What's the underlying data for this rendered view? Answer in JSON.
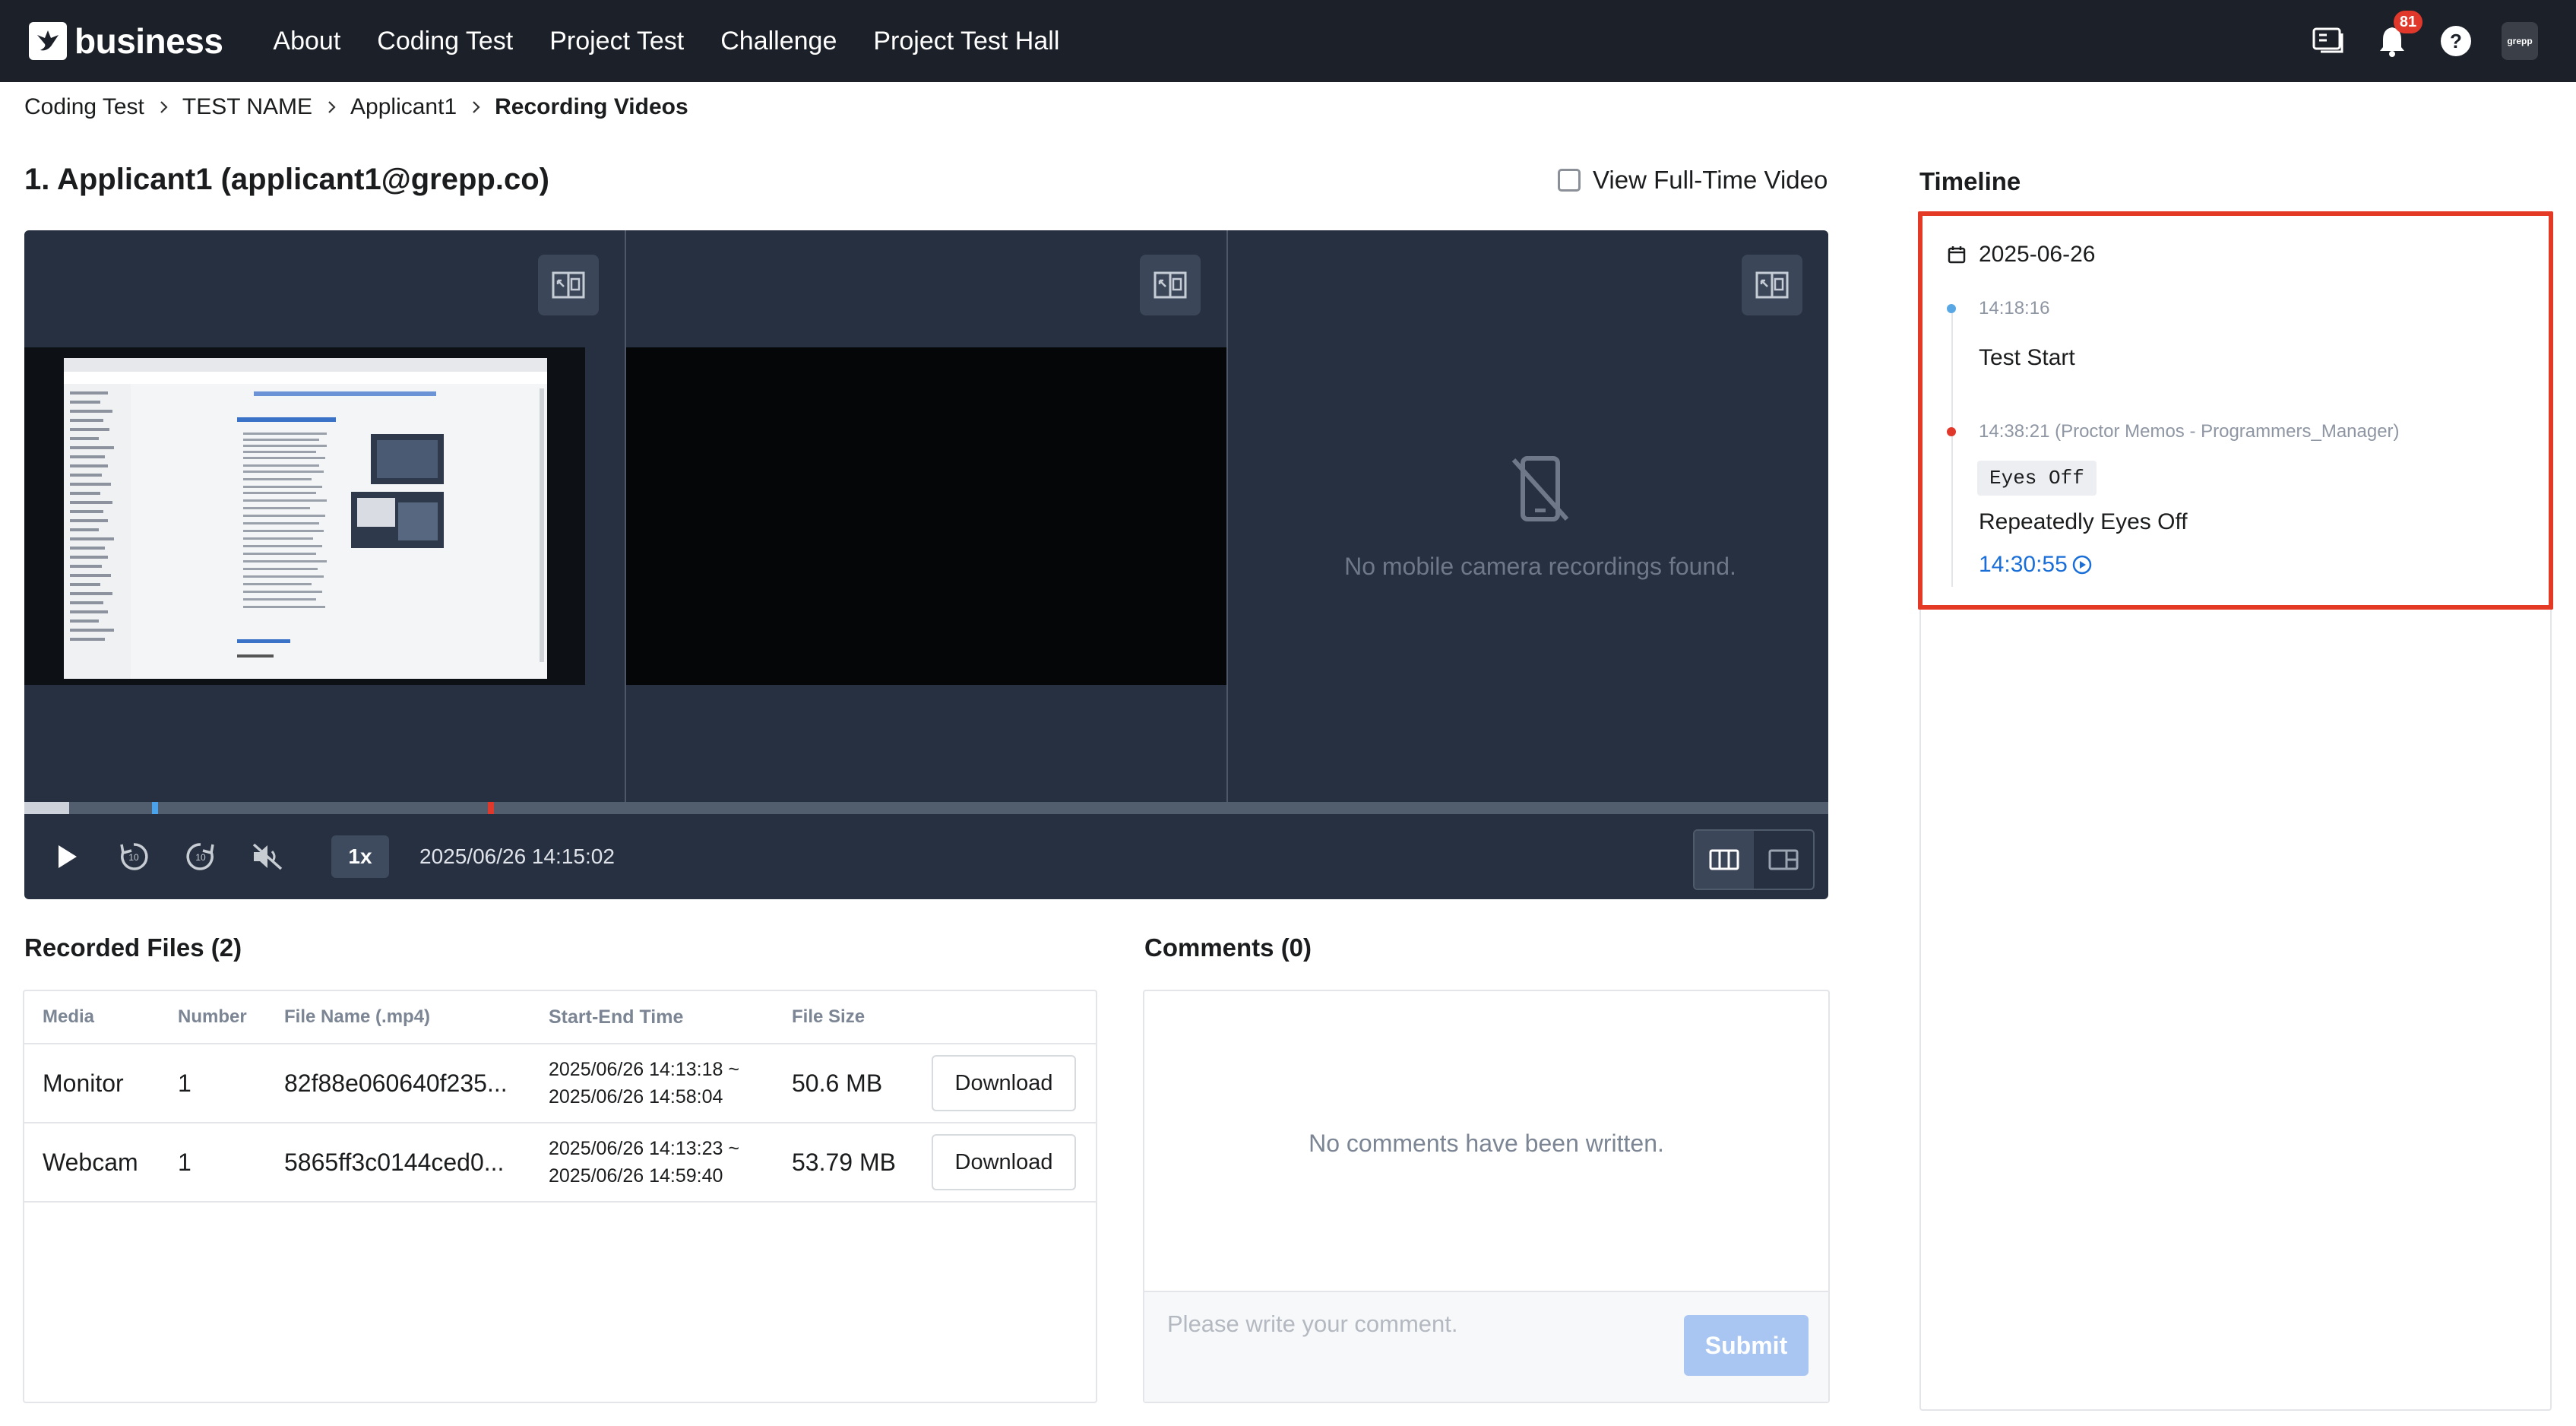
{
  "header": {
    "brand": "business",
    "nav": [
      "About",
      "Coding Test",
      "Project Test",
      "Challenge",
      "Project Test Hall"
    ],
    "notification_count": "81",
    "avatar_text": "grepp"
  },
  "breadcrumb": [
    "Coding Test",
    "TEST NAME",
    "Applicant1",
    "Recording Videos"
  ],
  "applicant": {
    "title": "1. Applicant1 (applicant1@grepp.co)",
    "fulltime_label": "View Full-Time Video"
  },
  "player": {
    "no_mobile_text": "No mobile camera recordings found.",
    "speed": "1x",
    "timestamp": "2025/06/26 14:15:02",
    "progress": 0.025
  },
  "recorded_files": {
    "title": "Recorded Files (2)",
    "columns": [
      "Media",
      "Number",
      "File Name (.mp4)",
      "Start-End Time",
      "File Size"
    ],
    "rows": [
      {
        "media": "Monitor",
        "number": "1",
        "file_name": "82f88e060640f235...",
        "start": "2025/06/26 14:13:18 ~",
        "end": "2025/06/26 14:58:04",
        "size": "50.6 MB",
        "action": "Download"
      },
      {
        "media": "Webcam",
        "number": "1",
        "file_name": "5865ff3c0144ced0...",
        "start": "2025/06/26 14:13:23 ~",
        "end": "2025/06/26 14:59:40",
        "size": "53.79 MB",
        "action": "Download"
      }
    ]
  },
  "comments": {
    "title": "Comments (0)",
    "empty_text": "No comments have been written.",
    "placeholder": "Please write your comment.",
    "submit": "Submit"
  },
  "timeline": {
    "title": "Timeline",
    "date": "2025-06-26",
    "events": [
      {
        "time": "14:18:16",
        "label": "Test Start",
        "color": "#5aa7e6"
      },
      {
        "time": "14:38:21 (Proctor Memos - Programmers_Manager)",
        "tag": "Eyes Off",
        "label": "Repeatedly Eyes Off",
        "link": "14:30:55",
        "color": "#e0392b"
      }
    ]
  },
  "colors": {
    "nav_bg": "#1c2028",
    "player_bg": "#263040",
    "accent_blue": "#1a6ed8",
    "highlight_red": "#e43a25"
  }
}
